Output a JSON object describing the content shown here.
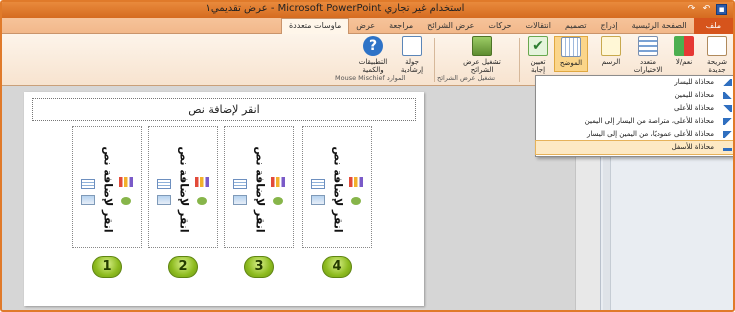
{
  "window": {
    "title": "عرض تقديمي١ - Microsoft PowerPoint استخدام غير تجاري"
  },
  "qat": [
    "save-icon",
    "undo-icon",
    "redo-icon"
  ],
  "tabs": [
    {
      "label": "ملف",
      "kind": "file"
    },
    {
      "label": "الصفحة الرئيسية"
    },
    {
      "label": "إدراج"
    },
    {
      "label": "تصميم"
    },
    {
      "label": "انتقالات"
    },
    {
      "label": "حركات"
    },
    {
      "label": "عرض الشرائح"
    },
    {
      "label": "مراجعة"
    },
    {
      "label": "عرض"
    },
    {
      "label": "ماوسات متعددة",
      "kind": "active"
    }
  ],
  "ribbon": {
    "new_slide": "شريحة جديدة",
    "yes_no": "نعم/لا",
    "multiple_choice": "متعدد الاختيارات",
    "drawing": "الرسم",
    "layout": "الموضح",
    "assign_answer": "تعيين إجابة",
    "run_slideshow": "تشغيل عرض الشرائح",
    "tour": "جولة إرشادية",
    "apps_and_quantity": "التطبيقات والكمية",
    "group_slideshow": "تشغيل عرض الشرائح",
    "group_resources": "Mouse Mischief الموارد"
  },
  "dropdown": {
    "items": [
      {
        "label": "محاذاة لليسار",
        "icon": "align-left-arrow-icon"
      },
      {
        "label": "محاذاة لليمين",
        "icon": "align-right-arrow-icon"
      },
      {
        "label": "محاذاة للأعلى",
        "icon": "align-top-arrow-icon"
      },
      {
        "label": "محاذاة للأعلى، متراصة من اليسار إلى اليمين",
        "icon": "align-top-ltr-icon"
      },
      {
        "label": "محاذاة للأعلى عموديًا، من اليمين إلى اليسار",
        "icon": "align-top-rtl-icon"
      },
      {
        "label": "محاذاة للأسفل",
        "icon": "align-bottom-arrow-icon"
      }
    ]
  },
  "slide": {
    "title_placeholder": "انقر لإضافة نص",
    "columns": [
      {
        "text": "انقر لإضافة نص",
        "number": "1"
      },
      {
        "text": "انقر لإضافة نص",
        "number": "2"
      },
      {
        "text": "انقر لإضافة نص",
        "number": "3"
      },
      {
        "text": "انقر لإضافة نص",
        "number": "4"
      }
    ]
  },
  "colors": {
    "titlebar": "#e07a2a",
    "ribbon": "#fdf4ea",
    "number_badge": "#8dbb1f"
  }
}
